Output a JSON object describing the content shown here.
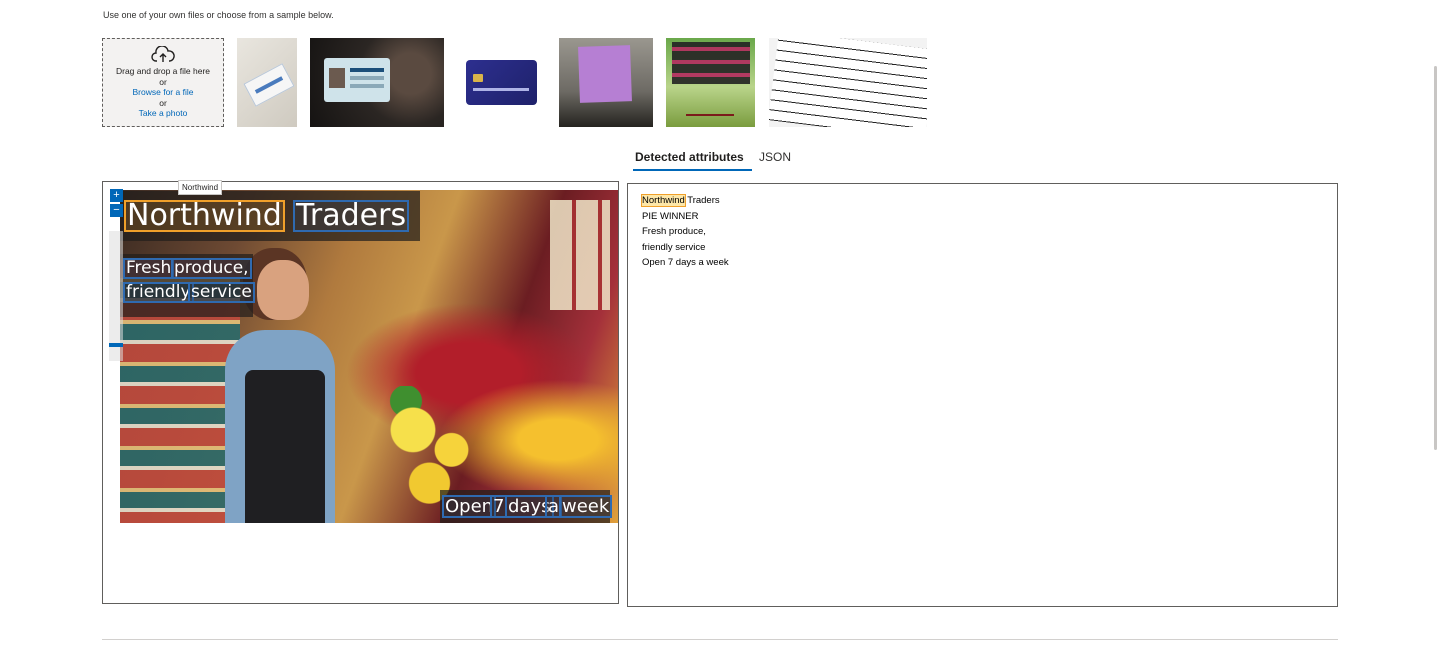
{
  "instructions": "Use one of your own files or choose from a sample below.",
  "dropzone": {
    "drag_text": "Drag and drop a file here",
    "or1": "or",
    "browse_link": "Browse for a file",
    "or2": "or",
    "photo_link": "Take a photo"
  },
  "samples": [
    "social-security-card",
    "id-card-held",
    "credit-card",
    "handwritten-sticky-note",
    "motivational-poster",
    "nutrition-facts-label"
  ],
  "tabs": [
    {
      "label": "Detected attributes",
      "active": true
    },
    {
      "label": "JSON",
      "active": false
    }
  ],
  "image": {
    "tooltip": "Northwind",
    "zoom_in": "+",
    "zoom_out": "−",
    "words": [
      {
        "text": "Northwind",
        "selected": true
      },
      {
        "text": "Traders"
      },
      {
        "text": "Fresh"
      },
      {
        "text": "produce,"
      },
      {
        "text": "friendly"
      },
      {
        "text": "service"
      },
      {
        "text": "Open"
      },
      {
        "text": "7"
      },
      {
        "text": "days"
      },
      {
        "text": "a"
      },
      {
        "text": "week"
      }
    ]
  },
  "results": {
    "line1_highlight": "Northwind",
    "line1_rest": " Traders",
    "lines": [
      "PIE WINNER",
      "Fresh produce,",
      "friendly service",
      "Open 7 days a week"
    ]
  },
  "colors": {
    "accent": "#0067b8",
    "selected_box": "#f0a02a",
    "word_box": "#2f6ab0"
  }
}
